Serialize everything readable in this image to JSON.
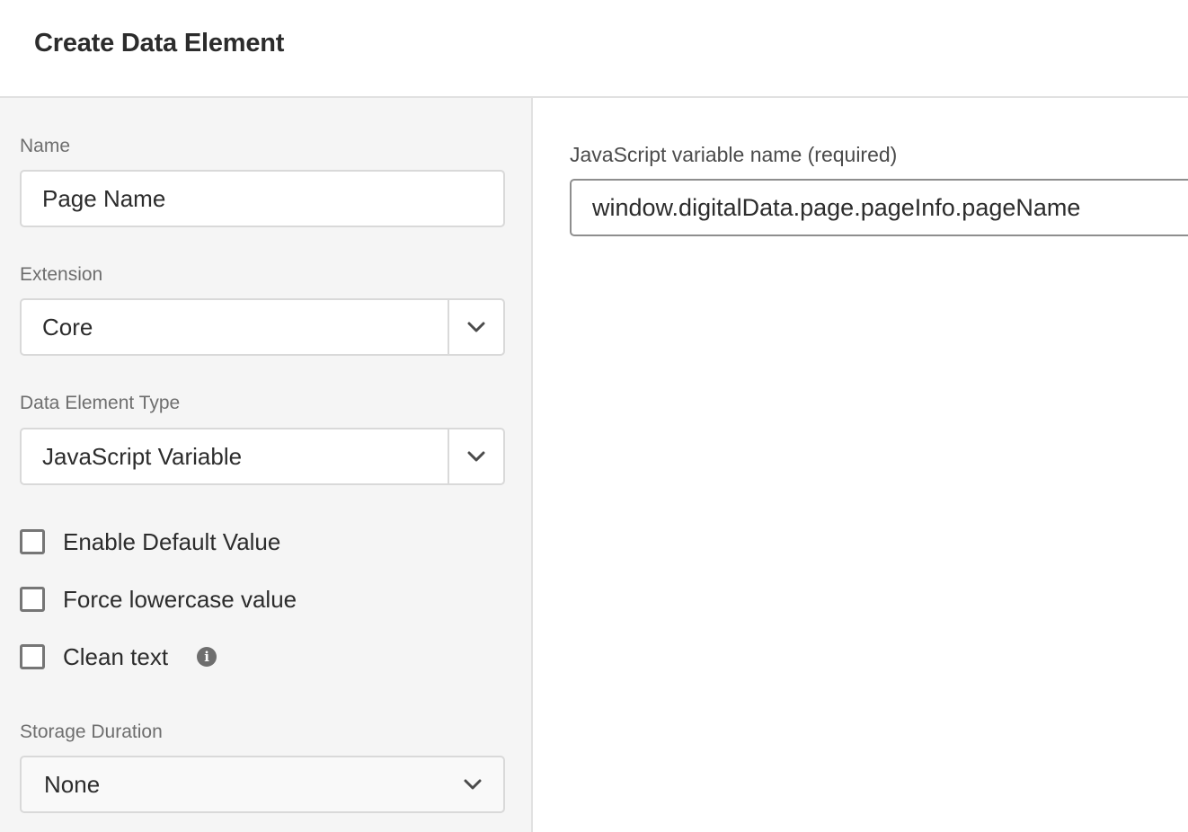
{
  "header": {
    "title": "Create Data Element"
  },
  "form": {
    "name": {
      "label": "Name",
      "value": "Page Name"
    },
    "extension": {
      "label": "Extension",
      "value": "Core",
      "icon": "chevron-down-icon"
    },
    "data_element_type": {
      "label": "Data Element Type",
      "value": "JavaScript Variable",
      "icon": "chevron-down-icon"
    },
    "checkboxes": [
      {
        "label": "Enable Default Value",
        "checked": false
      },
      {
        "label": "Force lowercase value",
        "checked": false
      },
      {
        "label": "Clean text",
        "checked": false,
        "info_icon": "info-icon",
        "info_glyph": "i"
      }
    ],
    "storage_duration": {
      "label": "Storage Duration",
      "value": "None",
      "icon": "chevron-down-icon"
    }
  },
  "settings": {
    "variable_name": {
      "label": "JavaScript variable name (required)",
      "value": "window.digitalData.page.pageInfo.pageName"
    }
  }
}
